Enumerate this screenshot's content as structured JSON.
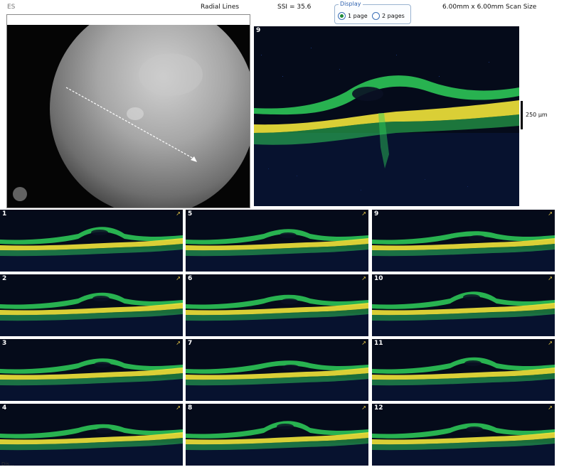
{
  "header": {
    "left_fragment": "ES",
    "scan_pattern": "Radial Lines",
    "ssi": "SSI = 35.6",
    "scan_size": "6.00mm x 6.00mm Scan Size"
  },
  "display": {
    "legend": "Display",
    "options": [
      {
        "label": "1 page",
        "selected": true
      },
      {
        "label": "2 pages",
        "selected": false
      }
    ]
  },
  "main_scan": {
    "label": "9",
    "scale_label": "250 µm"
  },
  "thumbnails": [
    {
      "label": "1"
    },
    {
      "label": "5"
    },
    {
      "label": "9"
    },
    {
      "label": "2"
    },
    {
      "label": "6"
    },
    {
      "label": "10"
    },
    {
      "label": "3"
    },
    {
      "label": "7"
    },
    {
      "label": "11"
    },
    {
      "label": "4"
    },
    {
      "label": "8"
    },
    {
      "label": "12"
    }
  ],
  "footer": {
    "text": "Dis..."
  },
  "colors": {
    "scan_bg": "#050b1a",
    "retina_green": "#2fd05a",
    "retina_yellow": "#f2e43a",
    "noise_blue": "#1e3f9c"
  }
}
